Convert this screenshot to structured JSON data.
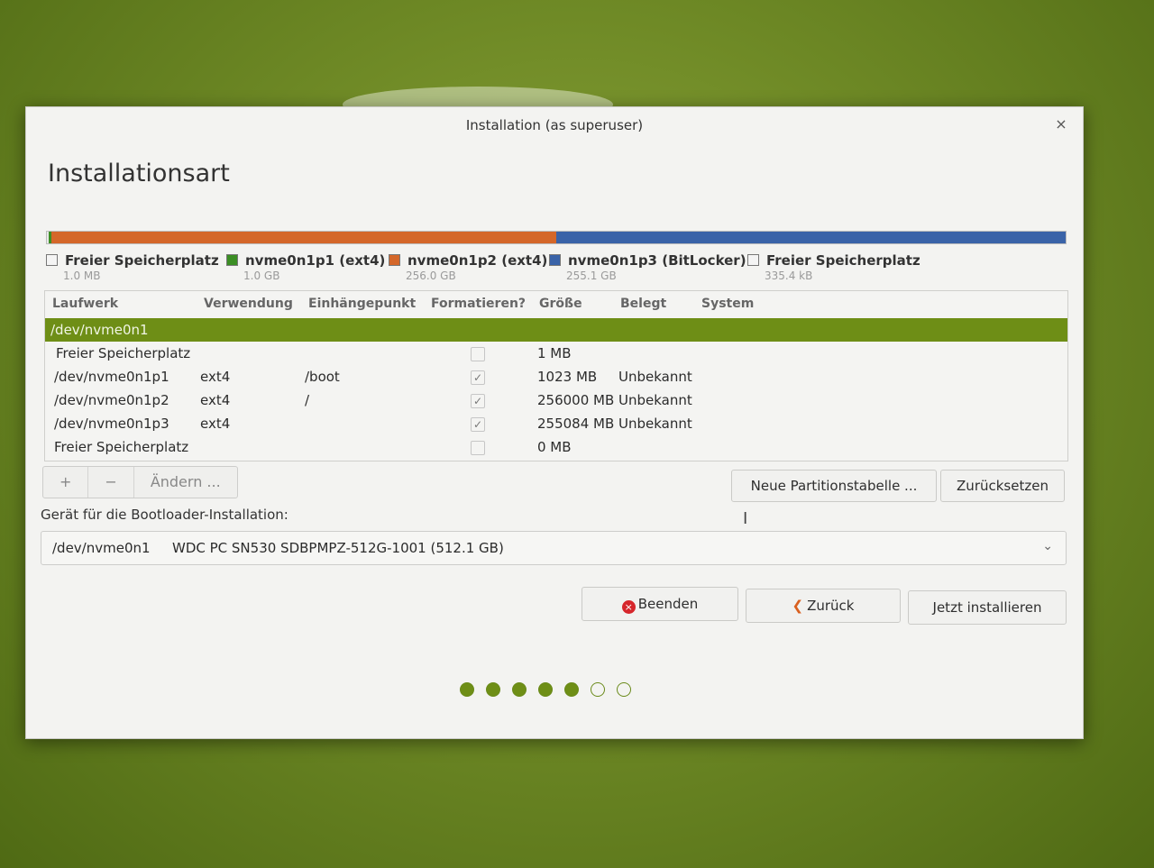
{
  "window": {
    "title": "Installation (as superuser)",
    "close_glyph": "×"
  },
  "page": {
    "title": "Installationsart"
  },
  "partition_bar": [
    {
      "name": "Freier Speicherplatz",
      "size": "1.0 MB",
      "color": "#e8e8e8",
      "fraction": 0.002
    },
    {
      "name": "nvme0n1p1 (ext4)",
      "size": "1.0 GB",
      "color": "#3b8e24",
      "fraction": 0.002
    },
    {
      "name": "nvme0n1p2 (ext4)",
      "size": "256.0 GB",
      "color": "#d4672a",
      "fraction": 0.496
    },
    {
      "name": "nvme0n1p3 (BitLocker)",
      "size": "255.1 GB",
      "color": "#3a63a8",
      "fraction": 0.5
    },
    {
      "name": "Freier Speicherplatz",
      "size": "335.4 kB",
      "color": "#e8e8e8",
      "fraction": 0.0
    }
  ],
  "table": {
    "headers": [
      "Laufwerk",
      "Verwendung",
      "Einhängepunkt",
      "Formatieren?",
      "Größe",
      "Belegt",
      "System"
    ],
    "rows": [
      {
        "drive": "/dev/nvme0n1",
        "usage": "",
        "mount": "",
        "format": null,
        "size": "",
        "used": "",
        "system": "",
        "selected": true
      },
      {
        "drive": "Freier Speicherplatz",
        "usage": "",
        "mount": "",
        "format": false,
        "size": "1 MB",
        "used": "",
        "system": ""
      },
      {
        "drive": "/dev/nvme0n1p1",
        "usage": "ext4",
        "mount": "/boot",
        "format": true,
        "size": "1023 MB",
        "used": "Unbekannt",
        "system": ""
      },
      {
        "drive": "/dev/nvme0n1p2",
        "usage": "ext4",
        "mount": "/",
        "format": true,
        "size": "256000 MB",
        "used": "Unbekannt",
        "system": ""
      },
      {
        "drive": "/dev/nvme0n1p3",
        "usage": "ext4",
        "mount": "",
        "format": true,
        "size": "255084 MB",
        "used": "Unbekannt",
        "system": ""
      },
      {
        "drive": "Freier Speicherplatz",
        "usage": "",
        "mount": "",
        "format": false,
        "size": "0 MB",
        "used": "",
        "system": ""
      }
    ]
  },
  "toolbar": {
    "add": "+",
    "remove": "−",
    "change": "Ändern ..."
  },
  "buttons": {
    "new_table": "Neue Partitionstabelle ...",
    "reset": "Zurücksetzen",
    "quit": "Beenden",
    "back": "Zurück",
    "install": "Jetzt installieren",
    "quit_icon": "×",
    "back_icon": "❮"
  },
  "bootloader": {
    "label": "Gerät für die Bootloader-Installation:",
    "device": "/dev/nvme0n1",
    "model": "WDC PC SN530 SDBPMPZ-512G-1001 (512.1 GB)",
    "arrow": "⌄"
  },
  "progress": {
    "total_steps": 7,
    "completed_steps": 5
  },
  "cursor_glyph": "I"
}
